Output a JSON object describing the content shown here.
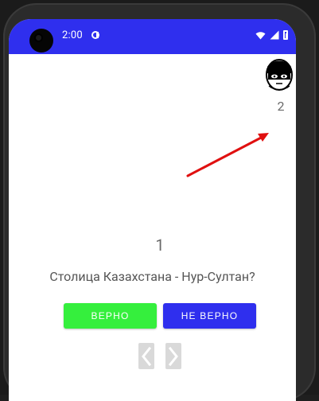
{
  "status_bar": {
    "time": "2:00",
    "bg_color": "#2f2fee",
    "icons": [
      "camera-hole",
      "app-icon",
      "wifi-icon",
      "signal-icon",
      "battery-icon"
    ]
  },
  "score_widget": {
    "icon": "bandit-avatar-icon",
    "value": "2"
  },
  "question": {
    "number": "1",
    "text": "Столица Казахстана - Нур-Султан?"
  },
  "buttons": {
    "true_label": "ВЕРНО",
    "false_label": "НЕ ВЕРНО",
    "true_color": "#35ef3d",
    "false_color": "#2f2fee"
  },
  "navigation": {
    "prev_icon": "chevron-left-icon",
    "next_icon": "chevron-right-icon"
  },
  "annotation": {
    "arrow_color": "#e01010"
  }
}
